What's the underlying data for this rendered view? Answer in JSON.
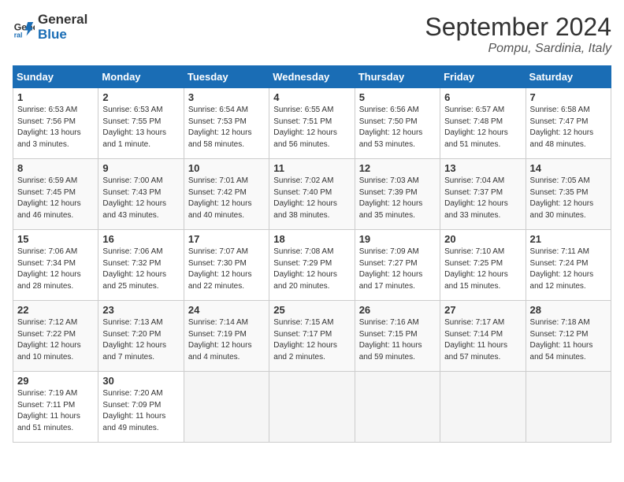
{
  "header": {
    "logo_line1": "General",
    "logo_line2": "Blue",
    "month": "September 2024",
    "location": "Pompu, Sardinia, Italy"
  },
  "weekdays": [
    "Sunday",
    "Monday",
    "Tuesday",
    "Wednesday",
    "Thursday",
    "Friday",
    "Saturday"
  ],
  "weeks": [
    [
      {
        "day": 1,
        "sunrise": "6:53 AM",
        "sunset": "7:56 PM",
        "daylight": "13 hours and 3 minutes"
      },
      {
        "day": 2,
        "sunrise": "6:53 AM",
        "sunset": "7:55 PM",
        "daylight": "13 hours and 1 minute"
      },
      {
        "day": 3,
        "sunrise": "6:54 AM",
        "sunset": "7:53 PM",
        "daylight": "12 hours and 58 minutes"
      },
      {
        "day": 4,
        "sunrise": "6:55 AM",
        "sunset": "7:51 PM",
        "daylight": "12 hours and 56 minutes"
      },
      {
        "day": 5,
        "sunrise": "6:56 AM",
        "sunset": "7:50 PM",
        "daylight": "12 hours and 53 minutes"
      },
      {
        "day": 6,
        "sunrise": "6:57 AM",
        "sunset": "7:48 PM",
        "daylight": "12 hours and 51 minutes"
      },
      {
        "day": 7,
        "sunrise": "6:58 AM",
        "sunset": "7:47 PM",
        "daylight": "12 hours and 48 minutes"
      }
    ],
    [
      {
        "day": 8,
        "sunrise": "6:59 AM",
        "sunset": "7:45 PM",
        "daylight": "12 hours and 46 minutes"
      },
      {
        "day": 9,
        "sunrise": "7:00 AM",
        "sunset": "7:43 PM",
        "daylight": "12 hours and 43 minutes"
      },
      {
        "day": 10,
        "sunrise": "7:01 AM",
        "sunset": "7:42 PM",
        "daylight": "12 hours and 40 minutes"
      },
      {
        "day": 11,
        "sunrise": "7:02 AM",
        "sunset": "7:40 PM",
        "daylight": "12 hours and 38 minutes"
      },
      {
        "day": 12,
        "sunrise": "7:03 AM",
        "sunset": "7:39 PM",
        "daylight": "12 hours and 35 minutes"
      },
      {
        "day": 13,
        "sunrise": "7:04 AM",
        "sunset": "7:37 PM",
        "daylight": "12 hours and 33 minutes"
      },
      {
        "day": 14,
        "sunrise": "7:05 AM",
        "sunset": "7:35 PM",
        "daylight": "12 hours and 30 minutes"
      }
    ],
    [
      {
        "day": 15,
        "sunrise": "7:06 AM",
        "sunset": "7:34 PM",
        "daylight": "12 hours and 28 minutes"
      },
      {
        "day": 16,
        "sunrise": "7:06 AM",
        "sunset": "7:32 PM",
        "daylight": "12 hours and 25 minutes"
      },
      {
        "day": 17,
        "sunrise": "7:07 AM",
        "sunset": "7:30 PM",
        "daylight": "12 hours and 22 minutes"
      },
      {
        "day": 18,
        "sunrise": "7:08 AM",
        "sunset": "7:29 PM",
        "daylight": "12 hours and 20 minutes"
      },
      {
        "day": 19,
        "sunrise": "7:09 AM",
        "sunset": "7:27 PM",
        "daylight": "12 hours and 17 minutes"
      },
      {
        "day": 20,
        "sunrise": "7:10 AM",
        "sunset": "7:25 PM",
        "daylight": "12 hours and 15 minutes"
      },
      {
        "day": 21,
        "sunrise": "7:11 AM",
        "sunset": "7:24 PM",
        "daylight": "12 hours and 12 minutes"
      }
    ],
    [
      {
        "day": 22,
        "sunrise": "7:12 AM",
        "sunset": "7:22 PM",
        "daylight": "12 hours and 10 minutes"
      },
      {
        "day": 23,
        "sunrise": "7:13 AM",
        "sunset": "7:20 PM",
        "daylight": "12 hours and 7 minutes"
      },
      {
        "day": 24,
        "sunrise": "7:14 AM",
        "sunset": "7:19 PM",
        "daylight": "12 hours and 4 minutes"
      },
      {
        "day": 25,
        "sunrise": "7:15 AM",
        "sunset": "7:17 PM",
        "daylight": "12 hours and 2 minutes"
      },
      {
        "day": 26,
        "sunrise": "7:16 AM",
        "sunset": "7:15 PM",
        "daylight": "11 hours and 59 minutes"
      },
      {
        "day": 27,
        "sunrise": "7:17 AM",
        "sunset": "7:14 PM",
        "daylight": "11 hours and 57 minutes"
      },
      {
        "day": 28,
        "sunrise": "7:18 AM",
        "sunset": "7:12 PM",
        "daylight": "11 hours and 54 minutes"
      }
    ],
    [
      {
        "day": 29,
        "sunrise": "7:19 AM",
        "sunset": "7:11 PM",
        "daylight": "11 hours and 51 minutes"
      },
      {
        "day": 30,
        "sunrise": "7:20 AM",
        "sunset": "7:09 PM",
        "daylight": "11 hours and 49 minutes"
      },
      null,
      null,
      null,
      null,
      null
    ]
  ]
}
